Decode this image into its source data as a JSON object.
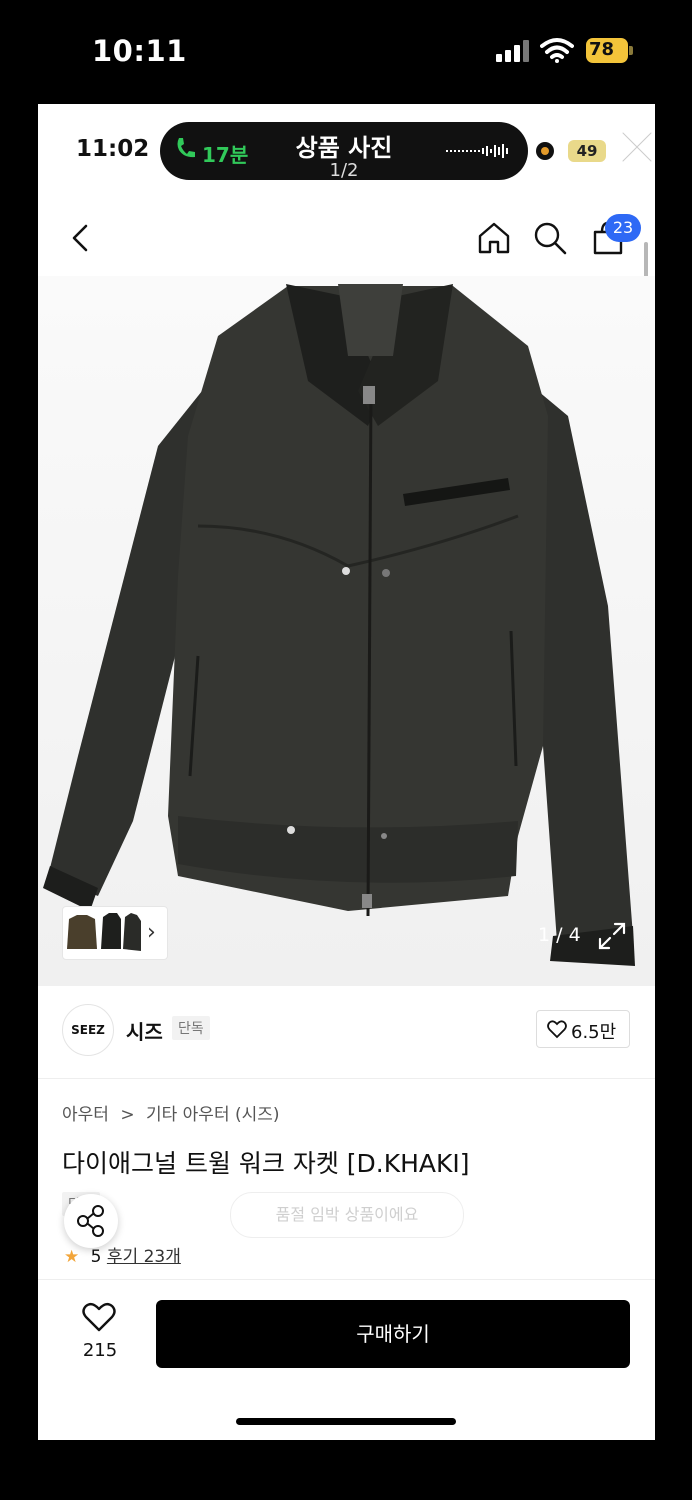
{
  "os_status": {
    "time": "10:11",
    "battery": "78"
  },
  "inner_status": {
    "time": "11:02",
    "call_duration": "17분",
    "battery": "49"
  },
  "viewer": {
    "title": "상품 사진",
    "count": "1/2"
  },
  "nav": {
    "cart_count": "23"
  },
  "hero": {
    "image_counter": "1 / 4"
  },
  "brand": {
    "logo_text": "SEEZ",
    "name": "시즈",
    "tag": "단독",
    "likes": "6.5만"
  },
  "breadcrumb": [
    "아우터",
    ">",
    "기타 아우터 (시즈)"
  ],
  "product": {
    "title": "다이애그널 트윌 워크 자켓 [D.KHAKI]",
    "tags": [
      "단독"
    ],
    "restock_text": "품절 임박 상품이에요",
    "rating": "5",
    "review_link": "후기 23개"
  },
  "bottom": {
    "wishlist_count": "215",
    "buy_label": "구매하기"
  },
  "colors": {
    "accent_blue": "#2e69f5",
    "call_green": "#31c95a",
    "battery_yellow": "#f3c43a",
    "star": "#f2a53a"
  }
}
